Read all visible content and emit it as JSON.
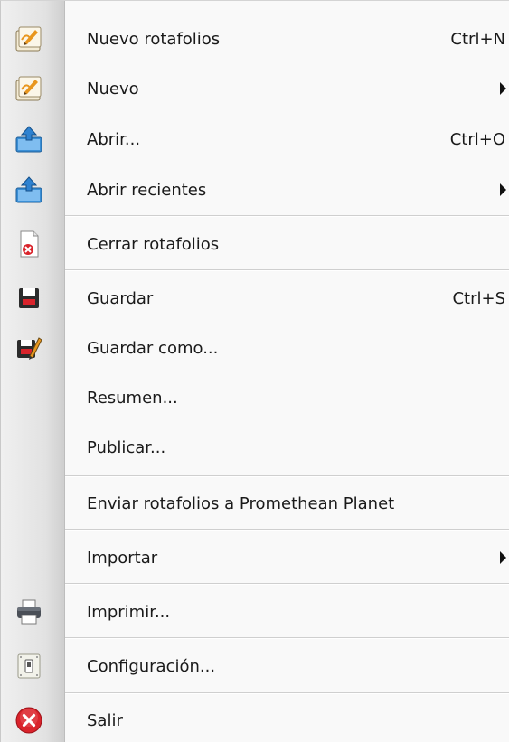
{
  "menu": {
    "items": [
      {
        "label": "Nuevo rotafolios",
        "shortcut": "Ctrl+N",
        "icon": "new-flipchart-icon"
      },
      {
        "label": "Nuevo",
        "submenu": true,
        "icon": "new-flipchart-icon"
      },
      {
        "label": "Abrir...",
        "shortcut": "Ctrl+O",
        "icon": "open-folder-icon"
      },
      {
        "label": "Abrir recientes",
        "submenu": true,
        "icon": "open-folder-icon"
      },
      {
        "label": "Cerrar rotafolios",
        "icon": "close-document-icon"
      },
      {
        "label": "Guardar",
        "shortcut": "Ctrl+S",
        "icon": "save-disk-icon"
      },
      {
        "label": "Guardar como...",
        "icon": "save-as-icon"
      },
      {
        "label": "Resumen...",
        "icon": ""
      },
      {
        "label": "Publicar...",
        "icon": ""
      },
      {
        "label": "Enviar rotafolios a Promethean Planet",
        "icon": ""
      },
      {
        "label": "Importar",
        "submenu": true,
        "icon": ""
      },
      {
        "label": "Imprimir...",
        "icon": "printer-icon"
      },
      {
        "label": "Configuración...",
        "icon": "settings-switch-icon"
      },
      {
        "label": "Salir",
        "icon": "exit-icon"
      }
    ]
  },
  "colors": {
    "exit_red": "#d9232b",
    "folder_blue": "#3a8fd6",
    "flipchart_orange": "#e8961e"
  }
}
